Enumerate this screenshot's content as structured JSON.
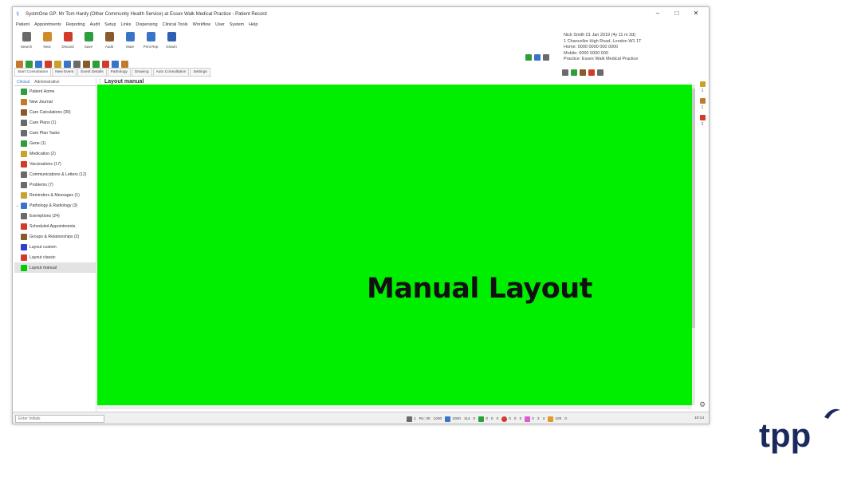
{
  "window": {
    "title": "SystmOne GP: Mr Tom Hardy (Other Community Health Service) at Essex Walk Medical Practice - Patient Record",
    "controls": {
      "minimize": "–",
      "maximize": "□",
      "close": "✕"
    }
  },
  "menu": [
    "Patient",
    "Appointments",
    "Reporting",
    "Audit",
    "Setup",
    "Links",
    "Dispensing",
    "Clinical Tools",
    "Workflow",
    "User",
    "System",
    "Help"
  ],
  "toolbar": [
    {
      "label": "Search",
      "icon": "magnifier-icon",
      "color": "#6a6a6a"
    },
    {
      "label": "Next",
      "icon": "next-icon",
      "color": "#d08a2a"
    },
    {
      "label": "Discard",
      "icon": "discard-icon",
      "color": "#d23b2b"
    },
    {
      "label": "Save",
      "icon": "save-icon",
      "color": "#2e9e3c"
    },
    {
      "label": "Audit",
      "icon": "audit-icon",
      "color": "#8a5a2a"
    },
    {
      "label": "Mute",
      "icon": "mute-icon",
      "color": "#3a74c8"
    },
    {
      "label": "Print Rep",
      "icon": "print-icon",
      "color": "#3a74c8"
    },
    {
      "label": "Glowin",
      "icon": "globe-icon",
      "color": "#2f5fb0"
    }
  ],
  "small_toolbar_colors": [
    "#c07b2b",
    "#2e9e3c",
    "#3a74c8",
    "#d23b2b",
    "#c7a32b",
    "#3a74c8",
    "#6a6a6a",
    "#8a5a2a",
    "#2e9e3c",
    "#d23b2b",
    "#3a74c8",
    "#c07b2b"
  ],
  "patient_info": [
    "Nick Smith 01 Jan 2019 (4y 11 m 3d)",
    "1 Chancellor High Road, London W1 1T",
    "Home: 0000 0000 000 0000",
    "Mobile: 0000 0000 000",
    "Practice: Essex Walk Medical Practice"
  ],
  "tabs": [
    {
      "label": "Start Consultation",
      "active": true
    },
    {
      "label": "New Event"
    },
    {
      "label": "Event Details"
    },
    {
      "label": "Pathology"
    },
    {
      "label": "Drawing"
    },
    {
      "label": "Auto Consultation"
    },
    {
      "label": "Settings"
    }
  ],
  "sidebar": {
    "tabs": [
      "Clinical",
      "Administrative"
    ],
    "items": [
      {
        "label": "Patient Home",
        "color": "#2e9e3c"
      },
      {
        "label": "New Journal",
        "color": "#c07b2b"
      },
      {
        "label": "Care Calculations (30)",
        "color": "#8a5a2a"
      },
      {
        "label": "Care Plans (1)",
        "color": "#6a6a6a"
      },
      {
        "label": "Care Plan Tasks",
        "color": "#6a6a6a"
      },
      {
        "label": "Gene (1)",
        "color": "#2e9e3c"
      },
      {
        "label": "Medication (2)",
        "color": "#c7a32b"
      },
      {
        "label": "Vaccinations (17)",
        "color": "#d23b2b"
      },
      {
        "label": "Communications & Letters (12)",
        "color": "#6a6a6a"
      },
      {
        "label": "Problems (7)",
        "color": "#6a6a6a"
      },
      {
        "label": "Reminders & Messages (1)",
        "color": "#c7a32b"
      },
      {
        "label": "Pathology & Radiology (3)",
        "color": "#3a74c8",
        "expander": "⌄"
      },
      {
        "label": "Exemptions (24)",
        "color": "#6a6a6a"
      },
      {
        "label": "Scheduled Appointments",
        "color": "#d23b2b"
      },
      {
        "label": "Groups & Relationships (2)",
        "color": "#8a5a2a"
      },
      {
        "label": "Layout custom",
        "color": "#2f3fc8"
      },
      {
        "label": "Layout classic",
        "color": "#d23b2b"
      },
      {
        "label": "Layout manual",
        "color": "#00cc00",
        "selected": true
      }
    ]
  },
  "content": {
    "title": "Layout manual",
    "panel_text": "Manual Layout",
    "panel_color": "#00ee00"
  },
  "right_strip": [
    "1",
    "1",
    "2"
  ],
  "statusbar": {
    "search_placeholder": "Enter Initials",
    "items": [
      "1",
      "Rx: 30",
      "1000",
      "1000",
      "114",
      "0",
      "0",
      "0",
      "0",
      "0",
      "0",
      "0",
      "0",
      "3",
      "3",
      "100",
      "0"
    ],
    "time": "10:14"
  },
  "logo": {
    "text": "tpp",
    "color": "#1b2a5c"
  }
}
